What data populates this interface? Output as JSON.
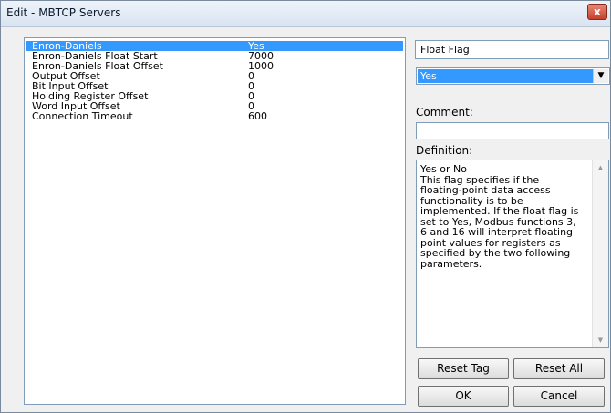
{
  "window": {
    "title": "Edit - MBTCP Servers",
    "close_label": "x"
  },
  "params": [
    {
      "name": "Enron-Daniels",
      "value": "Yes",
      "selected": true
    },
    {
      "name": "Enron-Daniels Float Start",
      "value": "7000"
    },
    {
      "name": "Enron-Daniels Float Offset",
      "value": "1000"
    },
    {
      "name": "Output Offset",
      "value": "0"
    },
    {
      "name": "Bit Input Offset",
      "value": "0"
    },
    {
      "name": "Holding Register Offset",
      "value": "0"
    },
    {
      "name": "Word Input Offset",
      "value": "0"
    },
    {
      "name": "Connection Timeout",
      "value": "600"
    }
  ],
  "field_name": "Float Flag",
  "value_select": {
    "selected": "Yes"
  },
  "comment": {
    "label": "Comment:",
    "value": ""
  },
  "definition": {
    "label": "Definition:",
    "text": "Yes or No\nThis flag specifies if the\nfloating-point data access\nfunctionality is to be\nimplemented. If the float flag is\nset to Yes, Modbus functions 3,\n6 and 16 will interpret floating\npoint values for registers as\nspecified by the two following\nparameters."
  },
  "buttons": {
    "reset_tag": "Reset Tag",
    "reset_all": "Reset All",
    "ok": "OK",
    "cancel": "Cancel"
  },
  "colors": {
    "selection": "#3399ff",
    "close": "#c4402c"
  }
}
